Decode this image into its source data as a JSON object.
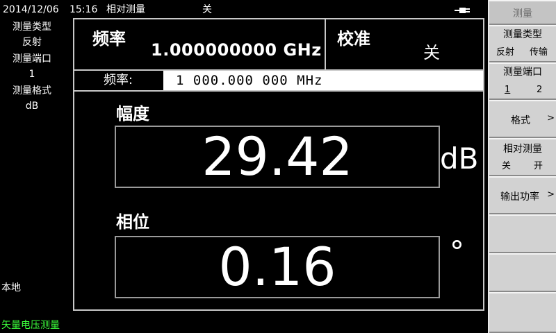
{
  "status": {
    "date": "2014/12/06",
    "time": "15:16",
    "relative_label": "相对测量",
    "relative_state": "关"
  },
  "left_info": {
    "meas_type_label": "测量类型",
    "meas_type_value": "反射",
    "port_label": "测量端口",
    "port_value": "1",
    "format_label": "测量格式",
    "format_value": "dB",
    "local": "本地",
    "mode": "矢量电压测量"
  },
  "header": {
    "freq_label": "频率",
    "freq_value": "1.000000000 GHz",
    "cal_label": "校准",
    "cal_value": "关"
  },
  "entry": {
    "label": "频率:",
    "value": "1 000.000 000 MHz"
  },
  "amplitude": {
    "label": "幅度",
    "value": "29.42",
    "unit": "dB"
  },
  "phase": {
    "label": "相位",
    "value": "0.16",
    "unit": "°"
  },
  "softkeys": {
    "title": "测量",
    "meas_type": {
      "label": "测量类型",
      "opt1": "反射",
      "opt2": "传输"
    },
    "port": {
      "label": "测量端口",
      "opt1": "1",
      "opt2": "2"
    },
    "format": {
      "label": "格式",
      "arrow": ">"
    },
    "relative": {
      "label": "相对测量",
      "opt1": "关",
      "opt2": "开"
    },
    "output_power": {
      "label": "输出功率",
      "arrow": ">"
    }
  },
  "colors": {
    "background": "#000000",
    "mode_text": "#3cff3c",
    "softkey_bg": "#d2d2d2"
  }
}
